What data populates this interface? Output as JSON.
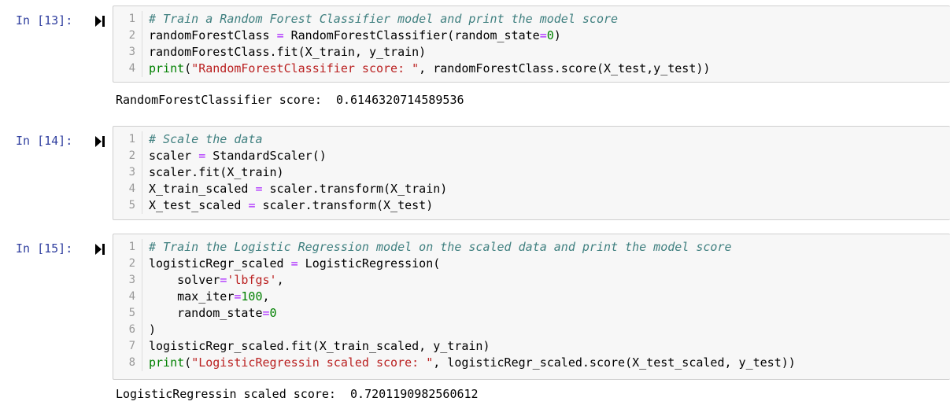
{
  "cells": [
    {
      "prompt": "In [13]:",
      "lines": [
        {
          "n": "1",
          "tokens": [
            {
              "t": "# Train a Random Forest Classifier model and print the model score",
              "c": "comment"
            }
          ]
        },
        {
          "n": "2",
          "tokens": [
            {
              "t": "randomForestClass ",
              "c": ""
            },
            {
              "t": "=",
              "c": "op"
            },
            {
              "t": " RandomForestClassifier(random_state",
              "c": ""
            },
            {
              "t": "=",
              "c": "op"
            },
            {
              "t": "0",
              "c": "number"
            },
            {
              "t": ")",
              "c": ""
            }
          ]
        },
        {
          "n": "3",
          "tokens": [
            {
              "t": "randomForestClass.fit(X_train, y_train)",
              "c": ""
            }
          ]
        },
        {
          "n": "4",
          "tokens": [
            {
              "t": "print",
              "c": "kw"
            },
            {
              "t": "(",
              "c": ""
            },
            {
              "t": "\"RandomForestClassifier score: \"",
              "c": "string"
            },
            {
              "t": ", randomForestClass.score(X_test,y_test))",
              "c": ""
            }
          ]
        }
      ],
      "output": "RandomForestClassifier score:  0.6146320714589536"
    },
    {
      "prompt": "In [14]:",
      "lines": [
        {
          "n": "1",
          "tokens": [
            {
              "t": "# Scale the data",
              "c": "comment"
            }
          ]
        },
        {
          "n": "2",
          "tokens": [
            {
              "t": "scaler ",
              "c": ""
            },
            {
              "t": "=",
              "c": "op"
            },
            {
              "t": " StandardScaler()",
              "c": ""
            }
          ]
        },
        {
          "n": "3",
          "tokens": [
            {
              "t": "scaler.fit(X_train)",
              "c": ""
            }
          ]
        },
        {
          "n": "4",
          "tokens": [
            {
              "t": "X_train_scaled ",
              "c": ""
            },
            {
              "t": "=",
              "c": "op"
            },
            {
              "t": " scaler.transform(X_train)",
              "c": ""
            }
          ]
        },
        {
          "n": "5",
          "tokens": [
            {
              "t": "X_test_scaled ",
              "c": ""
            },
            {
              "t": "=",
              "c": "op"
            },
            {
              "t": " scaler.transform(X_test)",
              "c": ""
            }
          ]
        }
      ],
      "output": ""
    },
    {
      "prompt": "In [15]:",
      "lines": [
        {
          "n": "1",
          "tokens": [
            {
              "t": "# Train the Logistic Regression model on the scaled data and print the model score",
              "c": "comment"
            }
          ]
        },
        {
          "n": "2",
          "tokens": [
            {
              "t": "logisticRegr_scaled ",
              "c": ""
            },
            {
              "t": "=",
              "c": "op"
            },
            {
              "t": " LogisticRegression(",
              "c": ""
            }
          ]
        },
        {
          "n": "3",
          "tokens": [
            {
              "t": "    solver",
              "c": ""
            },
            {
              "t": "=",
              "c": "op"
            },
            {
              "t": "'lbfgs'",
              "c": "string"
            },
            {
              "t": ",",
              "c": ""
            }
          ]
        },
        {
          "n": "4",
          "tokens": [
            {
              "t": "    max_iter",
              "c": ""
            },
            {
              "t": "=",
              "c": "op"
            },
            {
              "t": "100",
              "c": "number"
            },
            {
              "t": ",",
              "c": ""
            }
          ]
        },
        {
          "n": "5",
          "tokens": [
            {
              "t": "    random_state",
              "c": ""
            },
            {
              "t": "=",
              "c": "op"
            },
            {
              "t": "0",
              "c": "number"
            }
          ]
        },
        {
          "n": "6",
          "tokens": [
            {
              "t": ")",
              "c": ""
            }
          ]
        },
        {
          "n": "7",
          "tokens": [
            {
              "t": "logisticRegr_scaled.fit(X_train_scaled, y_train)",
              "c": ""
            }
          ]
        },
        {
          "n": "8",
          "tokens": [
            {
              "t": "print",
              "c": "kw"
            },
            {
              "t": "(",
              "c": ""
            },
            {
              "t": "\"LogisticRegressin scaled score: \"",
              "c": "string"
            },
            {
              "t": ", logisticRegr_scaled.score(X_test_scaled, y_test))",
              "c": ""
            }
          ]
        }
      ],
      "output": "LogisticRegressin scaled score:  0.7201190982560612"
    }
  ],
  "icons": {
    "run": "run-cell-icon"
  },
  "colors": {
    "prompt": "#303f9f",
    "comment": "#408080",
    "string": "#ba2121",
    "number": "#008000",
    "operator": "#aa22ff",
    "cell_bg": "#f7f7f7"
  }
}
